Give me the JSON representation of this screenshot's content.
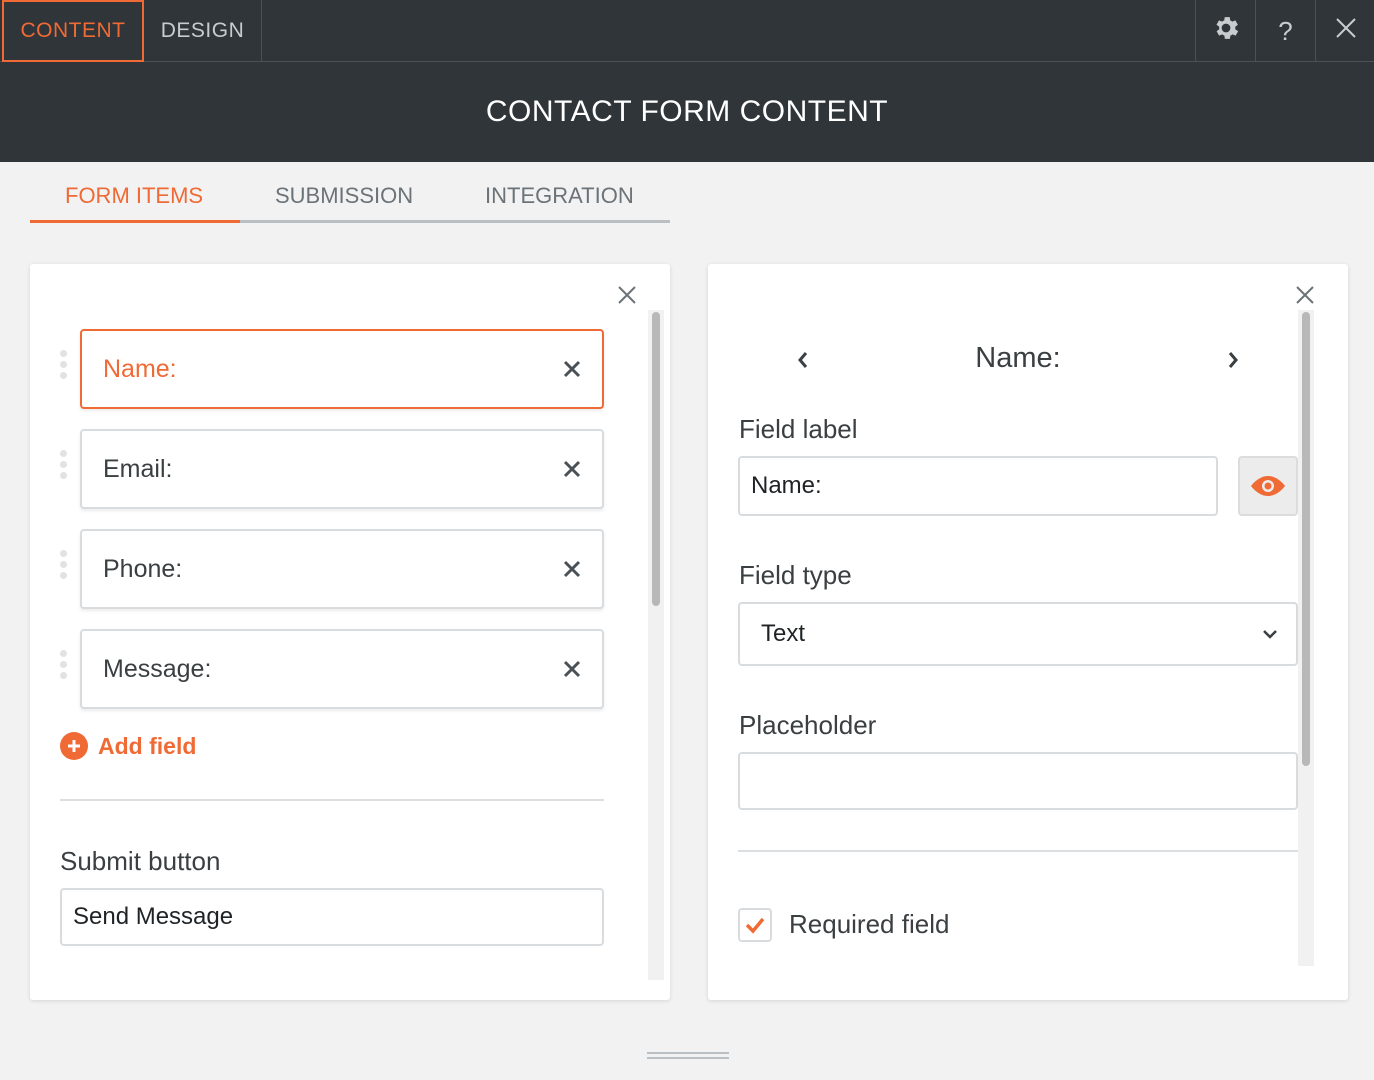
{
  "top_tabs": [
    {
      "label": "CONTENT",
      "active": true
    },
    {
      "label": "DESIGN",
      "active": false
    }
  ],
  "top_icons": [
    "gear-icon",
    "help-icon",
    "close-icon"
  ],
  "help_label": "?",
  "header": {
    "title": "CONTACT FORM CONTENT"
  },
  "sub_tabs": [
    {
      "label": "FORM ITEMS",
      "active": true
    },
    {
      "label": "SUBMISSION",
      "active": false
    },
    {
      "label": "INTEGRATION",
      "active": false
    }
  ],
  "form_items": {
    "fields": [
      {
        "label": "Name:",
        "active": true
      },
      {
        "label": "Email:",
        "active": false
      },
      {
        "label": "Phone:",
        "active": false
      },
      {
        "label": "Message:",
        "active": false
      }
    ],
    "add_field_label": "Add field",
    "submit_button_label": "Submit button",
    "submit_button_value": "Send Message"
  },
  "field_editor": {
    "current_field": "Name:",
    "field_label_title": "Field label",
    "field_label_value": "Name:",
    "field_type_title": "Field type",
    "field_type_value": "Text",
    "placeholder_title": "Placeholder",
    "placeholder_value": "",
    "required_label": "Required field",
    "required_checked": true
  },
  "colors": {
    "accent": "#f06a35",
    "dark_bar": "#2f3539",
    "background": "#f2f2f2"
  }
}
